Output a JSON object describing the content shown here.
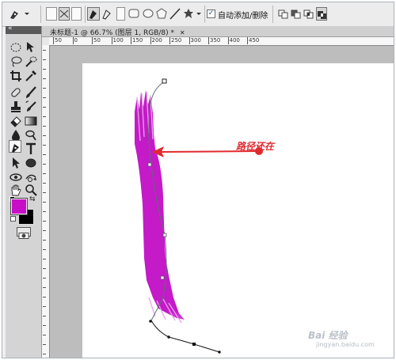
{
  "options_bar": {
    "auto_add_delete": {
      "label": "自动添加/删除",
      "checked": true
    }
  },
  "document": {
    "tab_title": "未标题-1 @ 66.7% (图层 1, RGB/8) *",
    "close_glyph": "✕"
  },
  "rulers": {
    "top_labels": [
      "50",
      "0",
      "50",
      "100",
      "150",
      "200",
      "250",
      "300",
      "350",
      "400",
      "450"
    ]
  },
  "toolbox": {
    "collapse_glyph": "«",
    "foreground_color": "#c80fc8",
    "background_color": "#000000"
  },
  "annotation": {
    "text": "路径还在",
    "color": "#e02a30"
  },
  "brush_stroke": {
    "color": "#c41ac8"
  },
  "watermark": {
    "text": "Bai 经验",
    "url": "jingyan.baidu.com"
  }
}
